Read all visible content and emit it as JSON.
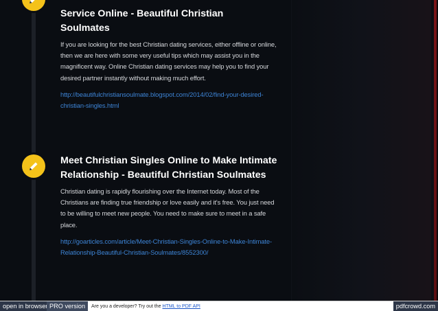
{
  "posts": [
    {
      "title_line1": "Service Online - Beautiful Christian",
      "title_line2": "Soulmates",
      "body": "If you are looking for the best Christian dating services, either offline or online, then we are here with some very useful tips which may assist you in the magnificent way. Online Christian dating services may help you to find your desired partner instantly without making much effort.",
      "link": "http://beautifulchristiansoulmate.blogspot.com/2014/02/find-your-desired-christian-singles.html"
    },
    {
      "title": "Meet Christian Singles Online to Make Intimate Relationship - Beautiful Christian Soulmates",
      "body": "Christian dating is rapidly flourishing over the Internet today. Most of the Christians are finding true friendship or love easily and it's free. You just need to be willing to meet new people. You need to make sure to meet in a safe place.",
      "link": "http://goarticles.com/article/Meet-Christian-Singles-Online-to-Make-Intimate-Relationship-Beautiful-Christian-Soulmates/8552300/"
    }
  ],
  "icons": {
    "post_badge": "pencil-icon"
  },
  "colors": {
    "badge": "#f4c21a",
    "link": "#3d84d6",
    "title": "#ffffff"
  },
  "footer": {
    "open_in_browser": "open in browser",
    "pro_version": "PRO version",
    "dev_text": "Are you a developer? Try out the",
    "dev_link": "HTML to PDF API",
    "brand": "pdfcrowd.com"
  }
}
